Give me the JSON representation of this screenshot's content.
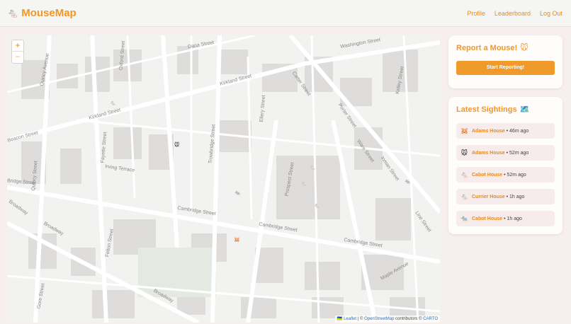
{
  "header": {
    "brand_icon": "🐁",
    "brand_name": "MouseMap",
    "nav": [
      "Profile",
      "Leaderboard",
      "Log Out"
    ]
  },
  "map": {
    "zoom_in": "+",
    "zoom_out": "−",
    "attribution": {
      "flag": "🇺🇦",
      "leaflet": "Leaflet",
      "sep1": " | © ",
      "osm": "OpenStreetMap",
      "mid": " contributors © ",
      "carto": "CARTO"
    },
    "streets": [
      "Kirkland Street",
      "Kirkland Street",
      "Cambridge Street",
      "Cambridge Street",
      "Cambridge Street",
      "Broadway",
      "Broadway",
      "Quincy Street",
      "Quincy Avenue",
      "Washington Street",
      "Dana Street",
      "Beacon Street",
      "Irving Terrace",
      "Bridge Street",
      "Broadway",
      "Trowbridge Street",
      "Ellery Street",
      "Prospect Street",
      "Line Street",
      "Inman Street",
      "Ware Street",
      "Maple Avenue",
      "Kelley Street",
      "Porter Street",
      "Felton Street",
      "Oxford Street",
      "Carter Street",
      "Fayette Street",
      "Gore Street"
    ],
    "markers": [
      "🐁",
      "🐭",
      "🐀",
      "🐁",
      "🐁",
      "🐁",
      "🐀",
      "🐹"
    ]
  },
  "report": {
    "title": "Report a Mouse!",
    "title_icon": "🐭",
    "button": "Start Reporting!"
  },
  "sightings": {
    "title": "Latest Sightings",
    "title_icon": "🗺️",
    "items": [
      {
        "icon": "🐹",
        "place": "Adams House",
        "time": " • 46m ago"
      },
      {
        "icon": "🐭",
        "place": "Adams House",
        "time": " • 52m ago"
      },
      {
        "icon": "🐁",
        "place": "Cabot House",
        "time": " • 52m ago"
      },
      {
        "icon": "🐁",
        "place": "Currier House",
        "time": " • 1h ago"
      },
      {
        "icon": "🐀",
        "place": "Cabot House",
        "time": " • 1h ago"
      }
    ]
  },
  "colors": {
    "accent": "#f0962a",
    "button": "#f19a2c",
    "page_bg": "#f7eeee",
    "item_bg": "#f7ecec"
  }
}
